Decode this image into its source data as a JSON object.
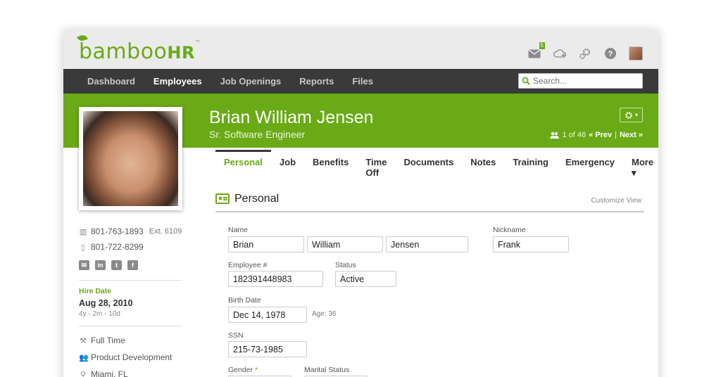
{
  "app": {
    "logo_text": "bamboo",
    "logo_hr": "HR",
    "logo_tm": "™",
    "inbox_count": "5"
  },
  "nav": {
    "items": [
      "Dashboard",
      "Employees",
      "Job Openings",
      "Reports",
      "Files"
    ],
    "active": "Employees",
    "search_placeholder": "Search..."
  },
  "employee": {
    "name": "Brian William Jensen",
    "title": "Sr. Software Engineer",
    "pager_count": "1 of 46",
    "prev": "« Prev",
    "next": "Next »",
    "pager_sep": "|"
  },
  "tabs": [
    "Personal",
    "Job",
    "Benefits",
    "Time Off",
    "Documents",
    "Notes",
    "Training",
    "Emergency",
    "More ▾"
  ],
  "section": {
    "title": "Personal",
    "customize": "Customize View"
  },
  "fields": {
    "name_label": "Name",
    "first": "Brian",
    "middle": "William",
    "last": "Jensen",
    "nickname_label": "Nickname",
    "nickname": "Frank",
    "empnum_label": "Employee #",
    "empnum": "182391448983",
    "status_label": "Status",
    "status": "Active",
    "birth_label": "Birth Date",
    "birth": "Dec 14, 1978",
    "age": "Age: 36",
    "ssn_label": "SSN",
    "ssn": "215-73-1985",
    "gender_label": "Gender",
    "gender_req": "*",
    "marital_label": "Marital Status"
  },
  "sidebar": {
    "work_phone": "801-763-1893",
    "ext": "Ext. 6109",
    "mobile_phone": "801-722-8299",
    "hire_label": "Hire Date",
    "hire_date": "Aug 28, 2010",
    "hire_duration": "4y - 2m - 10d",
    "employment": "Full Time",
    "department": "Product Development",
    "location": "Miami, FL"
  },
  "icons": {
    "accent": "#6aaa16",
    "nav_bg": "#3a3a3a"
  }
}
